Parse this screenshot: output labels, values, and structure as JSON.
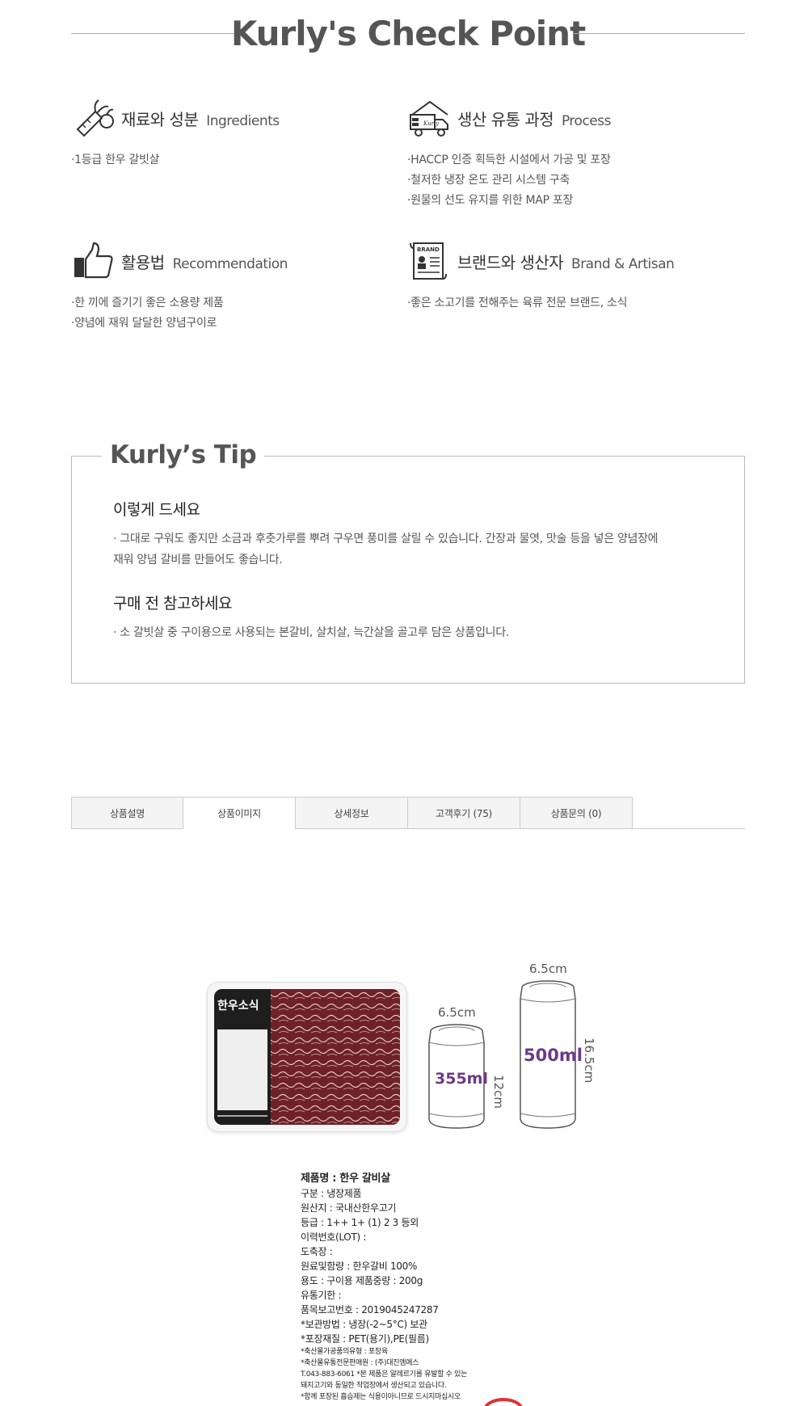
{
  "check_point": {
    "title": "Kurly's Check Point",
    "ingredients": {
      "title": "재료와 성분",
      "en": "Ingredients",
      "items": [
        "·1등급 한우 갈빗살"
      ]
    },
    "process": {
      "title": "생산 유통 과정",
      "en": "Process",
      "items": [
        "·HACCP 인증 획득한 시설에서 가공 및 포장",
        "·철저한 냉장 온도 관리 시스템 구축",
        "·원물의 선도 유지를 위한 MAP 포장"
      ]
    },
    "recommendation": {
      "title": "활용법",
      "en": "Recommendation",
      "items": [
        "·한 끼에 즐기기 좋은 소용량 제품",
        "·양념에 재워 달달한 양념구이로"
      ]
    },
    "brand": {
      "title": "브랜드와 생산자",
      "en": "Brand & Artisan",
      "items": [
        "·좋은 소고기를 전해주는 육류 전문 브랜드, 소식"
      ]
    },
    "process_icon_text": "Kurly",
    "brand_icon_text": "BRAND"
  },
  "tip": {
    "title": "Kurly’s Tip",
    "section1_title": "이렇게 드세요",
    "section1_line1": "· 그대로 구워도 좋지만 소금과 후춧가루를 뿌려 구우면 풍미를 살릴 수 있습니다. 간장과 물엿, 맛술 등을 넣은 양념장에",
    "section1_line2": "재워 양념 갈비를 만들어도 좋습니다.",
    "section2_title": "구매 전 참고하세요",
    "section2_line1": "· 소 갈빗살 중 구이용으로 사용되는 본갈비, 살치살, 늑간살을 골고루 담은 상품입니다."
  },
  "tabs": [
    {
      "label": "상품설명",
      "active": false
    },
    {
      "label": "상품이미지",
      "active": true
    },
    {
      "label": "상세정보",
      "active": false
    },
    {
      "label": "고객후기 (75)",
      "active": false
    },
    {
      "label": "상품문의 (0)",
      "active": false
    }
  ],
  "product_image": {
    "brand": "한우소식",
    "can1_width": "6.5cm",
    "can1_volume": "355ml",
    "can1_height": "12cm",
    "can2_width": "6.5cm",
    "can2_volume": "500ml",
    "can2_height": "16.5cm"
  },
  "spec_sheet": {
    "name": "제품명 : 한우 갈비살",
    "type": "구분 : 냉장제품",
    "origin": "원산지 : 국내산한우고기",
    "grade": "등급 : 1++   1+ (1)  2   3   등외",
    "lot": "이력번호(LOT) :",
    "slaughter": "도축장 :",
    "ingredient": "원료및함량 : 한우갈비 100%",
    "usage": "용도 : 구이용        제품중량 : 200g",
    "expiry": "유통기한 :",
    "report_no": "품목보고번호 : 2019045247287",
    "storage": "*보관방법 : 냉장(-2~5°C) 보관",
    "packaging": "*포장재질 : PET(용기),PE(필름)",
    "processing_type": "*축산물가공품의유형 : 포장육",
    "seller": "*축산물유통전문판매원 : (주)대진엠에스",
    "phone": "T.043-883-6061   *본 제품은 알레르기를 유발할 수 있는",
    "allergy": "돼지고기와 동일한 작업장에서 생산되고 있습니다.",
    "note": "*함께 포장된 흡습제는 식용이아니므로 드시지마십시오"
  }
}
